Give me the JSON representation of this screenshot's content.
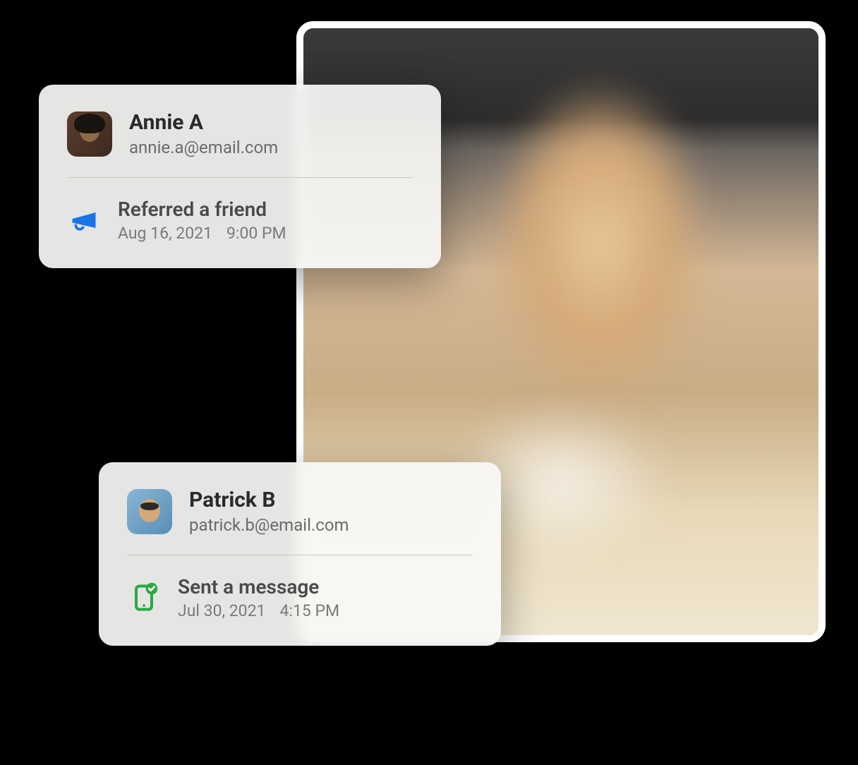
{
  "cards": [
    {
      "user": {
        "name": "Annie A",
        "email": "annie.a@email.com"
      },
      "activity": {
        "icon": "megaphone",
        "iconColor": "#1b73e8",
        "title": "Referred a friend",
        "date": "Aug 16, 2021",
        "time": "9:00 PM"
      }
    },
    {
      "user": {
        "name": "Patrick B",
        "email": "patrick.b@email.com"
      },
      "activity": {
        "icon": "phone-check",
        "iconColor": "#2aa843",
        "title": "Sent a message",
        "date": "Jul 30, 2021",
        "time": "4:15 PM"
      }
    }
  ]
}
